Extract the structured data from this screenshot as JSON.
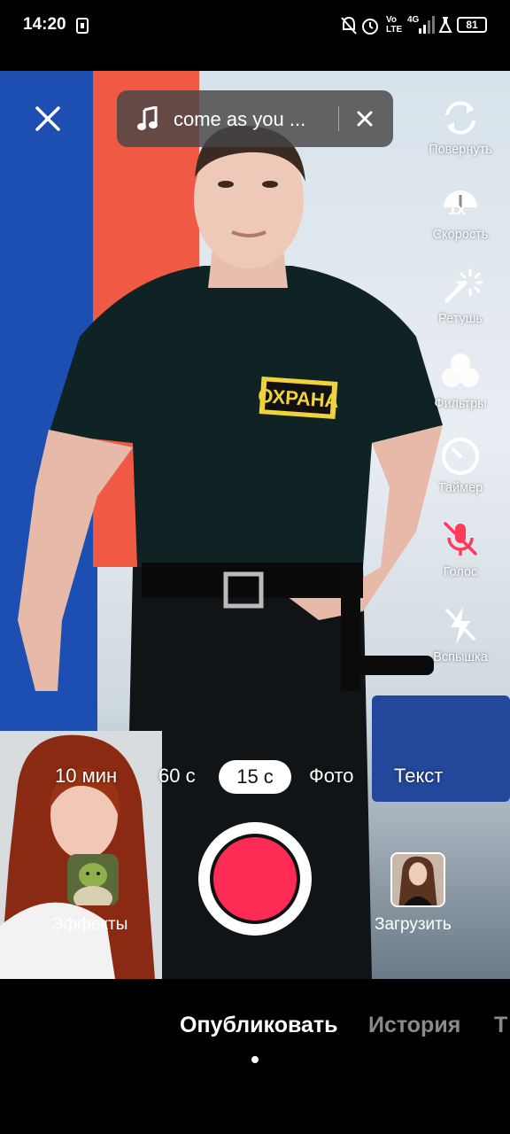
{
  "status_bar": {
    "time": "14:20",
    "battery": "81",
    "network": "4G",
    "volte": "Vo LTE",
    "icons": [
      "notification-off-icon",
      "alarm-icon",
      "signal-icon",
      "lab-icon",
      "battery-icon"
    ]
  },
  "music": {
    "title": "come as you ..."
  },
  "tools": [
    {
      "label": "Повернуть",
      "icon": "flip-camera-icon"
    },
    {
      "label": "Скорость",
      "icon": "speed-icon",
      "value": "1x"
    },
    {
      "label": "Ретушь",
      "icon": "beauty-wand-icon"
    },
    {
      "label": "Фильтры",
      "icon": "filters-icon"
    },
    {
      "label": "Таймер",
      "icon": "timer-icon"
    },
    {
      "label": "Голос",
      "icon": "mic-off-icon"
    },
    {
      "label": "Вспышка",
      "icon": "flash-off-icon"
    }
  ],
  "modes": {
    "items": [
      "10 мин",
      "60 с",
      "15 с",
      "Фото",
      "Текст"
    ],
    "selected": "15 с"
  },
  "bottom": {
    "effects_label": "Эффекты",
    "upload_label": "Загрузить"
  },
  "nav": {
    "publish": "Опубликовать",
    "story": "История",
    "more": "Т"
  },
  "colors": {
    "record": "#fe2c55",
    "mic_off": "#ff3b5c",
    "shirt_patch": "#f0d23c"
  }
}
